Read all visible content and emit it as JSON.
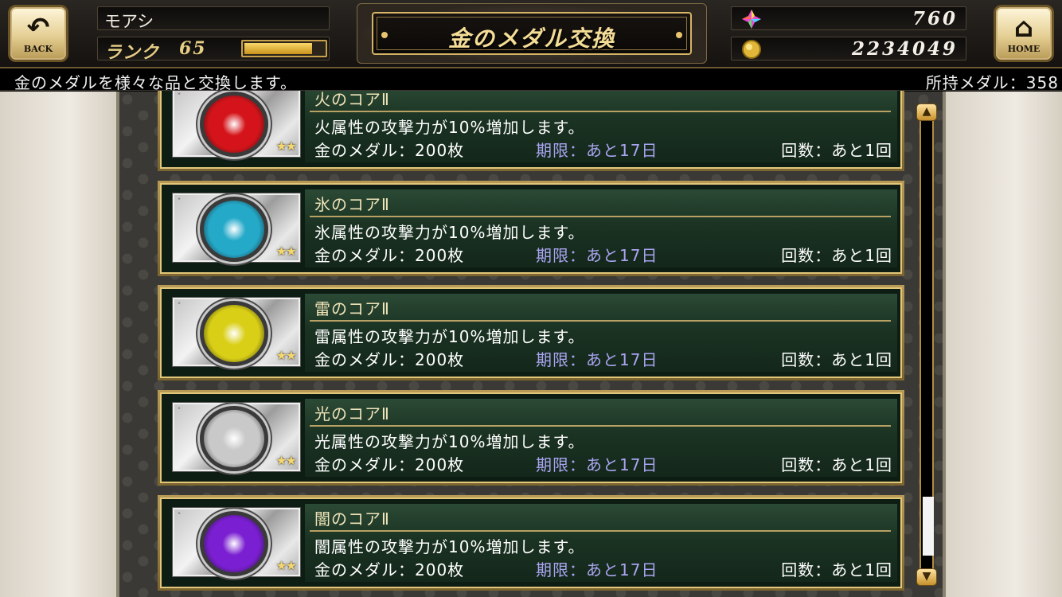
{
  "header": {
    "back_label": "BACK",
    "home_label": "HOME",
    "player_name": "モアシ",
    "rank_label": "ランク",
    "rank_value": "65",
    "exp_progress": 0.82,
    "title": "金のメダル交換",
    "crystal_icon": "rainbow-crystal-icon",
    "crystal_value": "760",
    "gil_icon": "gold-coin-icon",
    "gil_value": "2234049"
  },
  "sub_bar": {
    "description": "金のメダルを様々な品と交換します。",
    "owned": "所持メダル：358"
  },
  "items": [
    {
      "name": "火のコアⅡ",
      "description": "火属性の攻撃力が10%増加します。",
      "cost": "金のメダル：200枚",
      "deadline": "期限：あと17日",
      "count": "回数：あと1回",
      "icon": "fire-core-icon",
      "orb_color": "#d4141a",
      "rarity": "★★"
    },
    {
      "name": "氷のコアⅡ",
      "description": "氷属性の攻撃力が10%増加します。",
      "cost": "金のメダル：200枚",
      "deadline": "期限：あと17日",
      "count": "回数：あと1回",
      "icon": "ice-core-icon",
      "orb_color": "#25a9c9",
      "rarity": "★★"
    },
    {
      "name": "雷のコアⅡ",
      "description": "雷属性の攻撃力が10%増加します。",
      "cost": "金のメダル：200枚",
      "deadline": "期限：あと17日",
      "count": "回数：あと1回",
      "icon": "thunder-core-icon",
      "orb_color": "#d9cf16",
      "rarity": "★★"
    },
    {
      "name": "光のコアⅡ",
      "description": "光属性の攻撃力が10%増加します。",
      "cost": "金のメダル：200枚",
      "deadline": "期限：あと17日",
      "count": "回数：あと1回",
      "icon": "light-core-icon",
      "orb_color": "#c9c9c9",
      "rarity": "★★"
    },
    {
      "name": "闇のコアⅡ",
      "description": "闇属性の攻撃力が10%増加します。",
      "cost": "金のメダル：200枚",
      "deadline": "期限：あと17日",
      "count": "回数：あと1回",
      "icon": "dark-core-icon",
      "orb_color": "#7a1fd1",
      "rarity": "★★"
    }
  ],
  "scrollbar": {
    "position": 0.85
  },
  "colors": {
    "gold_accent": "#d6b465",
    "panel_green": "#1b3323",
    "deadline_text": "#a9a4f0"
  }
}
